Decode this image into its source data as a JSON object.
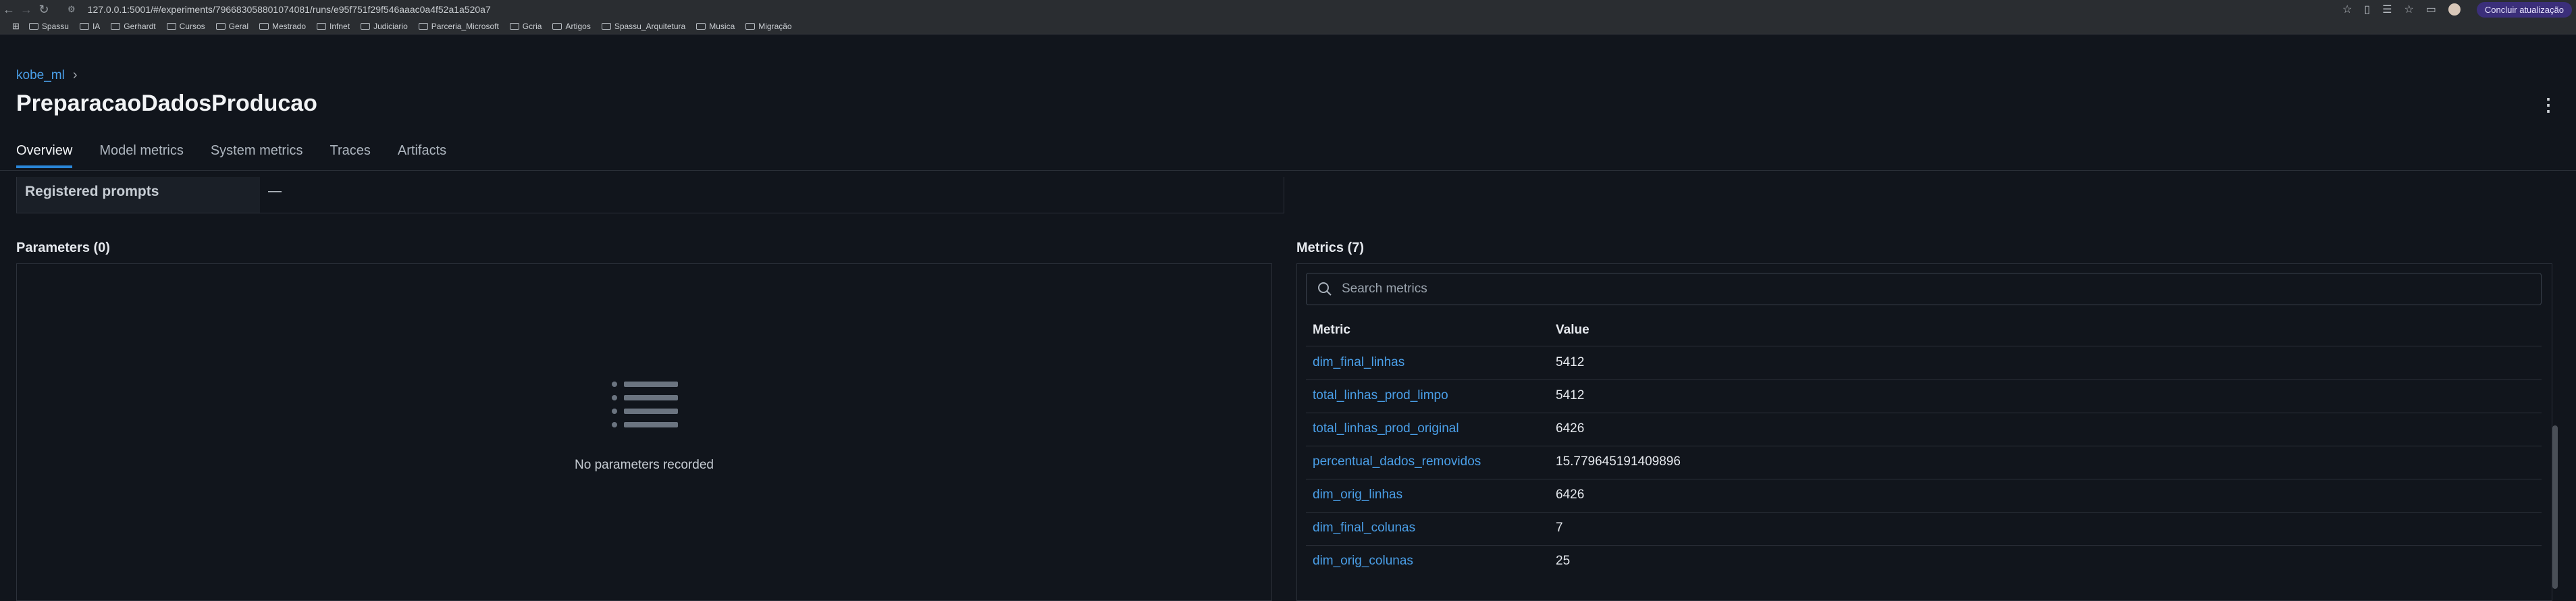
{
  "browser": {
    "url": "127.0.0.1:5001/#/experiments/796683058801074081/runs/e95f751f29f546aaac0a4f52a1a520a7",
    "update_button": "Concluir atualização",
    "bookmarks": [
      "Spassu",
      "IA",
      "Gerhardt",
      "Cursos",
      "Geral",
      "Mestrado",
      "Infnet",
      "Judiciario",
      "Parceria_Microsoft",
      "Gcria",
      "Artigos",
      "Spassu_Arquitetura",
      "Musica",
      "Migração"
    ]
  },
  "header": {
    "breadcrumb": "kobe_ml",
    "title": "PreparacaoDadosProducao",
    "tabs": [
      "Overview",
      "Model metrics",
      "System metrics",
      "Traces",
      "Artifacts"
    ]
  },
  "details": {
    "registered_prompts_label": "Registered prompts",
    "registered_prompts_value": "—"
  },
  "parameters": {
    "title": "Parameters (0)",
    "empty_text": "No parameters recorded"
  },
  "metrics": {
    "title": "Metrics (7)",
    "search_placeholder": "Search metrics",
    "col_metric": "Metric",
    "col_value": "Value",
    "rows": [
      {
        "name": "dim_final_linhas",
        "value": "5412"
      },
      {
        "name": "total_linhas_prod_limpo",
        "value": "5412"
      },
      {
        "name": "total_linhas_prod_original",
        "value": "6426"
      },
      {
        "name": "percentual_dados_removidos",
        "value": "15.779645191409896"
      },
      {
        "name": "dim_orig_linhas",
        "value": "6426"
      },
      {
        "name": "dim_final_colunas",
        "value": "7"
      },
      {
        "name": "dim_orig_colunas",
        "value": "25"
      }
    ]
  },
  "colors": {
    "background": "#11151c",
    "link": "#4a9fe8",
    "active_tab": "#2a86d8"
  }
}
